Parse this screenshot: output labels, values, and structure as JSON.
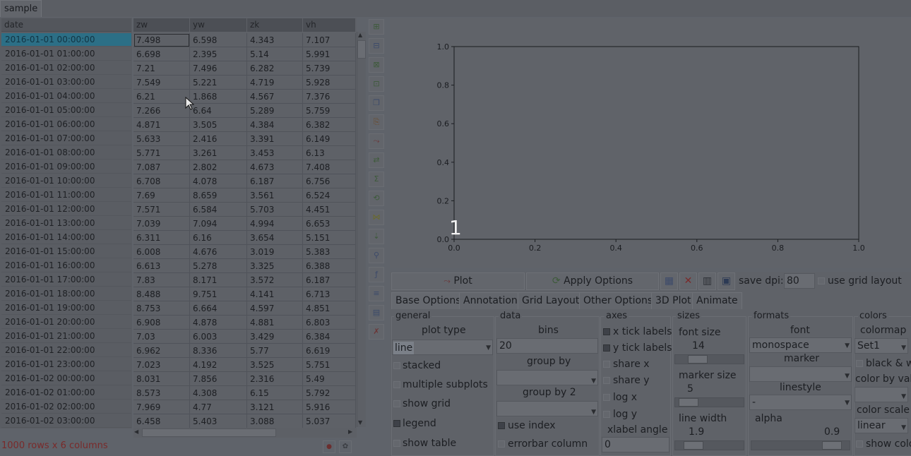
{
  "tabs": [
    "sample"
  ],
  "table": {
    "index_header": "date",
    "columns": [
      "zw",
      "yw",
      "zk",
      "vh"
    ],
    "rows": [
      [
        "2016-01-01 00:00:00",
        "7.498",
        "6.598",
        "4.343",
        "7.107"
      ],
      [
        "2016-01-01 01:00:00",
        "6.698",
        "2.395",
        "5.14",
        "5.991"
      ],
      [
        "2016-01-01 02:00:00",
        "7.21",
        "7.496",
        "6.282",
        "5.739"
      ],
      [
        "2016-01-01 03:00:00",
        "7.549",
        "5.221",
        "4.719",
        "5.928"
      ],
      [
        "2016-01-01 04:00:00",
        "6.21",
        "1.868",
        "4.567",
        "7.376"
      ],
      [
        "2016-01-01 05:00:00",
        "7.266",
        "6.64",
        "5.289",
        "5.759"
      ],
      [
        "2016-01-01 06:00:00",
        "4.871",
        "3.505",
        "4.384",
        "6.382"
      ],
      [
        "2016-01-01 07:00:00",
        "5.633",
        "2.416",
        "3.391",
        "6.149"
      ],
      [
        "2016-01-01 08:00:00",
        "5.771",
        "3.261",
        "3.453",
        "6.13"
      ],
      [
        "2016-01-01 09:00:00",
        "7.087",
        "2.802",
        "4.673",
        "7.408"
      ],
      [
        "2016-01-01 10:00:00",
        "6.708",
        "4.078",
        "6.187",
        "6.756"
      ],
      [
        "2016-01-01 11:00:00",
        "7.69",
        "8.659",
        "3.561",
        "6.524"
      ],
      [
        "2016-01-01 12:00:00",
        "7.571",
        "6.584",
        "5.703",
        "4.451"
      ],
      [
        "2016-01-01 13:00:00",
        "7.039",
        "7.094",
        "4.994",
        "6.653"
      ],
      [
        "2016-01-01 14:00:00",
        "6.311",
        "6.16",
        "3.654",
        "5.151"
      ],
      [
        "2016-01-01 15:00:00",
        "6.008",
        "4.676",
        "3.019",
        "5.383"
      ],
      [
        "2016-01-01 16:00:00",
        "6.613",
        "5.278",
        "3.325",
        "6.388"
      ],
      [
        "2016-01-01 17:00:00",
        "7.83",
        "8.171",
        "3.572",
        "6.187"
      ],
      [
        "2016-01-01 18:00:00",
        "8.488",
        "9.751",
        "4.141",
        "6.713"
      ],
      [
        "2016-01-01 19:00:00",
        "8.753",
        "6.664",
        "4.597",
        "4.851"
      ],
      [
        "2016-01-01 20:00:00",
        "6.908",
        "4.878",
        "4.881",
        "6.803"
      ],
      [
        "2016-01-01 21:00:00",
        "7.03",
        "6.003",
        "3.429",
        "6.384"
      ],
      [
        "2016-01-01 22:00:00",
        "6.962",
        "8.336",
        "5.77",
        "6.619"
      ],
      [
        "2016-01-01 23:00:00",
        "7.023",
        "4.192",
        "3.525",
        "5.751"
      ],
      [
        "2016-01-02 00:00:00",
        "8.031",
        "7.856",
        "2.316",
        "5.49"
      ],
      [
        "2016-01-02 01:00:00",
        "8.573",
        "4.308",
        "6.15",
        "5.792"
      ],
      [
        "2016-01-02 02:00:00",
        "7.969",
        "4.77",
        "3.121",
        "5.916"
      ],
      [
        "2016-01-02 03:00:00",
        "6.458",
        "5.403",
        "3.088",
        "5.037"
      ]
    ],
    "status": "1000 rows x 6 columns"
  },
  "toolbar_icons": [
    "add-row-icon",
    "add-column-icon",
    "delete-row-icon",
    "delete-column-icon",
    "copy-icon",
    "paste-icon",
    "plot-icon",
    "transpose-icon",
    "aggregate-icon",
    "pivot-icon",
    "merge-icon",
    "melt-icon",
    "filter-icon",
    "calc-icon",
    "summary-icon",
    "chart-icon",
    "clear-icon"
  ],
  "plot": {
    "y_ticks": [
      "1.0",
      "0.8",
      "0.6",
      "0.4",
      "0.2",
      "0.0"
    ],
    "x_ticks": [
      "0.0",
      "0.2",
      "0.4",
      "0.6",
      "0.8",
      "1.0"
    ],
    "overlay": "1"
  },
  "controls": {
    "plot_label": "Plot",
    "apply_label": "Apply Options",
    "save_dpi_label": "save dpi:",
    "save_dpi_value": "80",
    "grid_layout_label": "use grid layout",
    "tabs": [
      "Base Options",
      "Annotation",
      "Grid Layout",
      "Other Options",
      "3D Plot",
      "Animate"
    ],
    "general": {
      "title": "general",
      "plot_type_label": "plot type",
      "plot_type_value": "line",
      "stacked": "stacked",
      "multiple_subplots": "multiple subplots",
      "show_grid": "show grid",
      "legend": "legend",
      "show_table": "show table"
    },
    "data": {
      "title": "data",
      "bins_label": "bins",
      "bins_value": "20",
      "group_by": "group by",
      "group_by_2": "group by 2",
      "use_index": "use index",
      "errorbar_column": "errorbar column"
    },
    "axes": {
      "title": "axes",
      "x_tick_labels": "x tick labels",
      "y_tick_labels": "y tick labels",
      "share_x": "share x",
      "share_y": "share y",
      "log_x": "log x",
      "log_y": "log y",
      "xlabel_angle": "xlabel angle",
      "xlabel_angle_value": "0"
    },
    "sizes": {
      "title": "sizes",
      "font_size": "font size",
      "font_size_value": "14",
      "marker_size": "marker size",
      "marker_size_value": "5",
      "line_width": "line width",
      "line_width_value": "1.9"
    },
    "formats": {
      "title": "formats",
      "font": "font",
      "font_value": "monospace",
      "marker": "marker",
      "linestyle": "linestyle",
      "linestyle_value": "-",
      "alpha": "alpha",
      "alpha_value": "0.9"
    },
    "colors": {
      "title": "colors",
      "colormap": "colormap",
      "colormap_value": "Set1",
      "black_white": "black & w",
      "color_by_value": "color by val",
      "color_scale": "color scale",
      "color_scale_value": "linear",
      "show_colorbar": "show colo"
    }
  }
}
